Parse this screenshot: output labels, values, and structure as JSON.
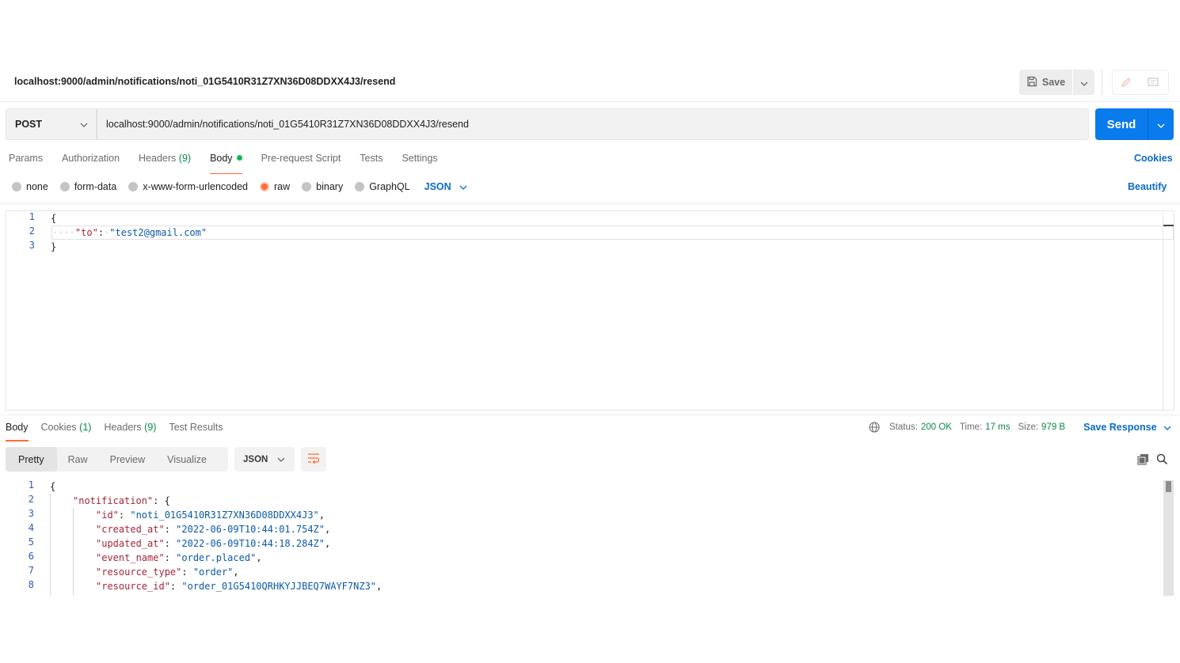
{
  "request": {
    "title": "localhost:9000/admin/notifications/noti_01G5410R31Z7XN36D08DDXX4J3/resend",
    "save_label": "Save",
    "method": "POST",
    "url": "localhost:9000/admin/notifications/noti_01G5410R31Z7XN36D08DDXX4J3/resend",
    "send_label": "Send",
    "colors": {
      "send": "#097bed",
      "accent": "#ff6c37",
      "link": "#0b6ac7",
      "success": "#0a8a49"
    }
  },
  "request_tabs": {
    "params": "Params",
    "authorization": "Authorization",
    "headers": "Headers",
    "headers_count": "(9)",
    "body": "Body",
    "prerequest": "Pre-request Script",
    "tests": "Tests",
    "settings": "Settings",
    "cookies": "Cookies"
  },
  "body_types": {
    "none": "none",
    "form_data": "form-data",
    "urlencoded": "x-www-form-urlencoded",
    "raw": "raw",
    "binary": "binary",
    "graphql": "GraphQL",
    "selected": "raw",
    "format": "JSON",
    "beautify": "Beautify"
  },
  "editor": {
    "line_numbers": [
      "1",
      "2",
      "3"
    ],
    "l1": "{",
    "l2_ws": "····",
    "l2_key": "\"to\"",
    "l2_colon": ":",
    "l2_ws2": "·",
    "l2_value": "\"test2@gmail.com\"",
    "l3": "}"
  },
  "response_tabs": {
    "body": "Body",
    "cookies": "Cookies",
    "cookies_count": "(1)",
    "headers": "Headers",
    "headers_count": "(9)",
    "test_results": "Test Results"
  },
  "response_meta": {
    "status_label": "Status:",
    "status_value": "200 OK",
    "time_label": "Time:",
    "time_value": "17 ms",
    "size_label": "Size:",
    "size_value": "979 B",
    "save_response": "Save Response"
  },
  "view_modes": {
    "pretty": "Pretty",
    "raw": "Raw",
    "preview": "Preview",
    "visualize": "Visualize",
    "format": "JSON"
  },
  "response_body": {
    "line_numbers": [
      "1",
      "2",
      "3",
      "4",
      "5",
      "6",
      "7",
      "8"
    ],
    "l1": "{",
    "l2_key": "\"notification\"",
    "l2_rest": ": {",
    "l3_key": "\"id\"",
    "l3_value": "\"noti_01G5410R31Z7XN36D08DDXX4J3\"",
    "l4_key": "\"created_at\"",
    "l4_value": "\"2022-06-09T10:44:01.754Z\"",
    "l5_key": "\"updated_at\"",
    "l5_value": "\"2022-06-09T10:44:18.284Z\"",
    "l6_key": "\"event_name\"",
    "l6_value": "\"order.placed\"",
    "l7_key": "\"resource_type\"",
    "l7_value": "\"order\"",
    "l8_key": "\"resource_id\"",
    "l8_value": "\"order_01G5410QRHKYJJBEQ7WAYF7NZ3\"",
    "colon": ": ",
    "comma": ","
  }
}
